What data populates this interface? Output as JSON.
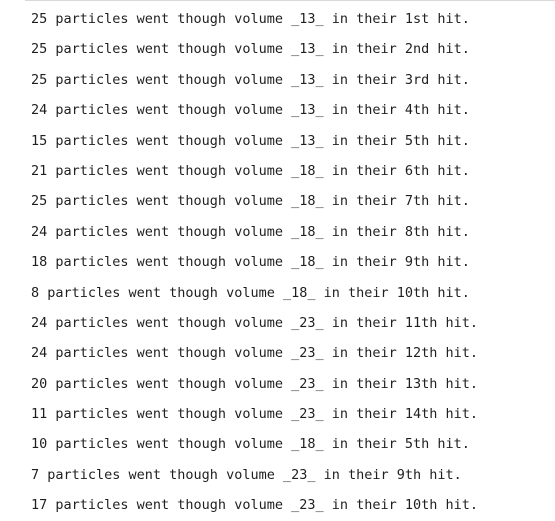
{
  "output": {
    "lines": [
      "25 particles went though volume _13_ in their 1st hit.",
      "25 particles went though volume _13_ in their 2nd hit.",
      "25 particles went though volume _13_ in their 3rd hit.",
      "24 particles went though volume _13_ in their 4th hit.",
      "15 particles went though volume _13_ in their 5th hit.",
      "21 particles went though volume _18_ in their 6th hit.",
      "25 particles went though volume _18_ in their 7th hit.",
      "24 particles went though volume _18_ in their 8th hit.",
      "18 particles went though volume _18_ in their 9th hit.",
      "8 particles went though volume _18_ in their 10th hit.",
      "24 particles went though volume _23_ in their 11th hit.",
      "24 particles went though volume _23_ in their 12th hit.",
      "20 particles went though volume _23_ in their 13th hit.",
      "11 particles went though volume _23_ in their 14th hit.",
      "10 particles went though volume _18_ in their 5th hit.",
      "7 particles went though volume _23_ in their 9th hit.",
      "17 particles went though volume _23_ in their 10th hit."
    ]
  }
}
